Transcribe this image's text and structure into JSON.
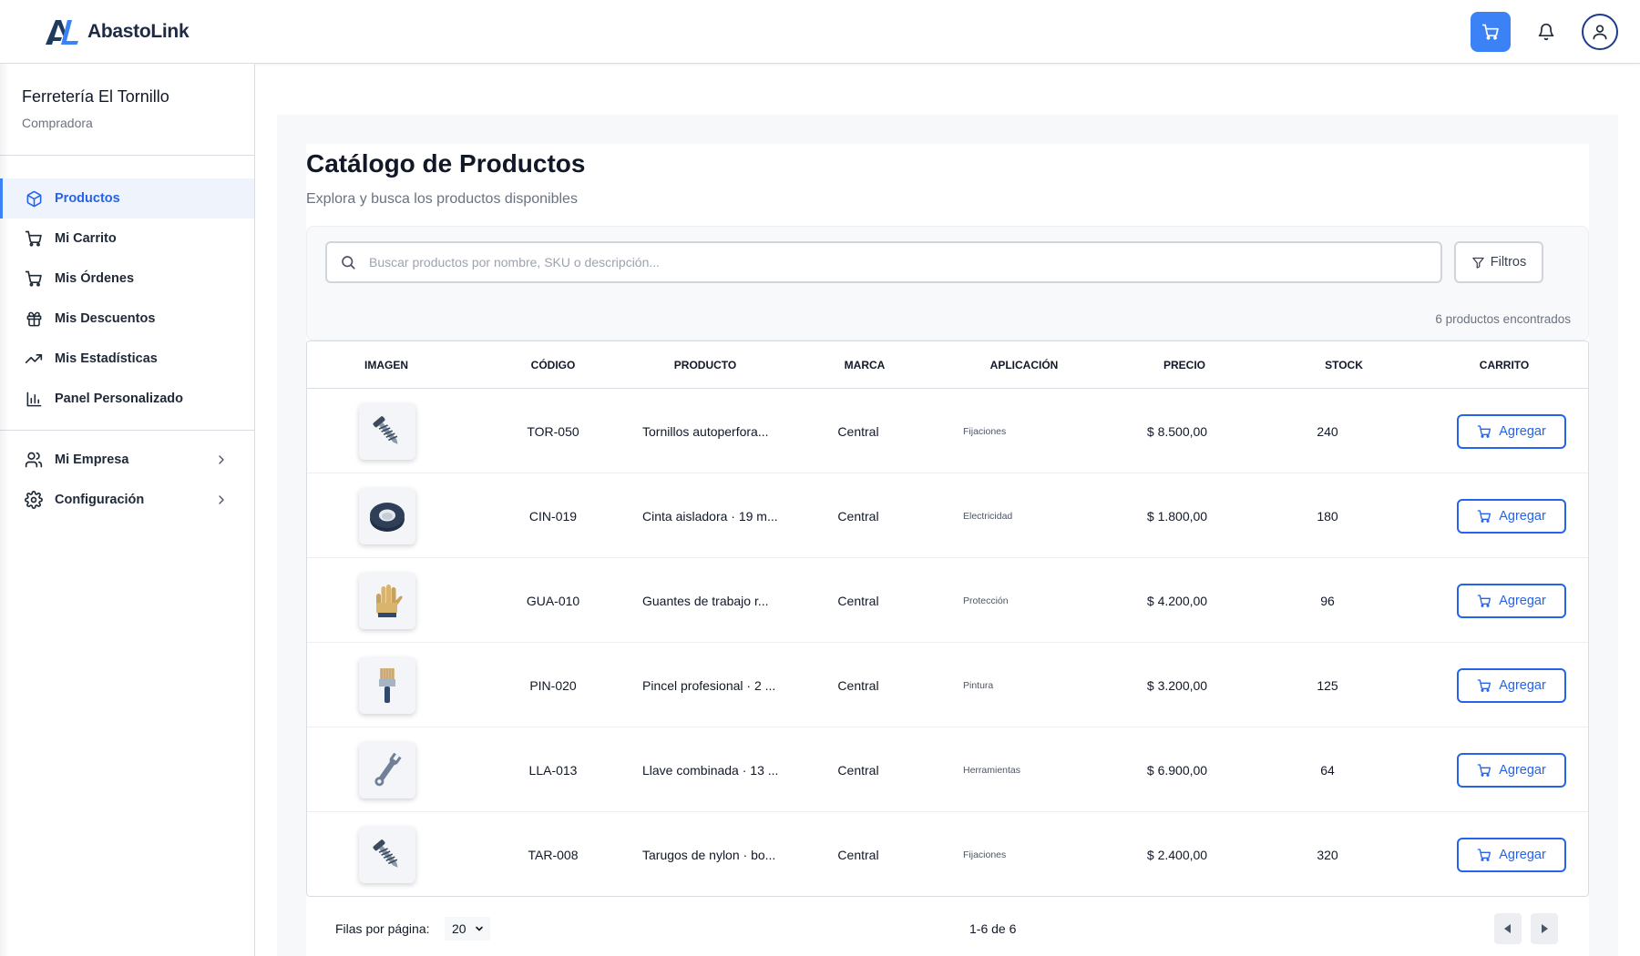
{
  "app": {
    "name": "AbastoLink",
    "logo_mark": "AL"
  },
  "header": {
    "icons": [
      "cart-icon",
      "bell-icon",
      "user-icon"
    ],
    "accent_color": "#3b82f6"
  },
  "sidebar": {
    "company_name": "Ferretería El Tornillo",
    "company_role": "Compradora",
    "items": [
      {
        "label": "Productos",
        "icon": "box-icon",
        "active": true
      },
      {
        "label": "Mi Carrito",
        "icon": "cart-icon"
      },
      {
        "label": "Mis Órdenes",
        "icon": "cart-icon"
      },
      {
        "label": "Mis Descuentos",
        "icon": "gift-icon"
      },
      {
        "label": "Mis Estadísticas",
        "icon": "trending-up-icon"
      },
      {
        "label": "Panel Personalizado",
        "icon": "bar-chart-icon"
      }
    ],
    "sections": [
      {
        "label": "Mi Empresa",
        "icon": "users-icon"
      },
      {
        "label": "Configuración",
        "icon": "gear-icon"
      }
    ]
  },
  "main": {
    "title": "Catálogo de Productos",
    "subtitle": "Explora y busca los productos disponibles",
    "search_placeholder": "Buscar productos por nombre, SKU o descripción...",
    "filters_label": "Filtros",
    "result_count": "6 productos encontrados"
  },
  "table": {
    "columns": [
      "IMAGEN",
      "CÓDIGO",
      "PRODUCTO",
      "MARCA",
      "APLICACIÓN",
      "PRECIO",
      "STOCK",
      "CARRITO"
    ],
    "add_label": "Agregar",
    "rows": [
      {
        "image": "screw-icon",
        "code": "TOR-050",
        "product": "Tornillos autoperfora...",
        "brand": "Central",
        "application": "Fijaciones",
        "price": "$ 8.500,00",
        "stock": "240"
      },
      {
        "image": "tape-icon",
        "code": "CIN-019",
        "product": "Cinta aisladora · 19 m...",
        "brand": "Central",
        "application": "Electricidad",
        "price": "$ 1.800,00",
        "stock": "180"
      },
      {
        "image": "glove-icon",
        "code": "GUA-010",
        "product": "Guantes de trabajo r...",
        "brand": "Central",
        "application": "Protección",
        "price": "$ 4.200,00",
        "stock": "96"
      },
      {
        "image": "brush-icon",
        "code": "PIN-020",
        "product": "Pincel profesional · 2 ...",
        "brand": "Central",
        "application": "Pintura",
        "price": "$ 3.200,00",
        "stock": "125"
      },
      {
        "image": "wrench-icon",
        "code": "LLA-013",
        "product": "Llave combinada · 13 ...",
        "brand": "Central",
        "application": "Herramientas",
        "price": "$ 6.900,00",
        "stock": "64"
      },
      {
        "image": "screw-icon",
        "code": "TAR-008",
        "product": "Tarugos de nylon · bo...",
        "brand": "Central",
        "application": "Fijaciones",
        "price": "$ 2.400,00",
        "stock": "320"
      }
    ]
  },
  "pagination": {
    "rows_label": "Filas por página:",
    "rows_value": "20",
    "range": "1-6 de 6"
  }
}
